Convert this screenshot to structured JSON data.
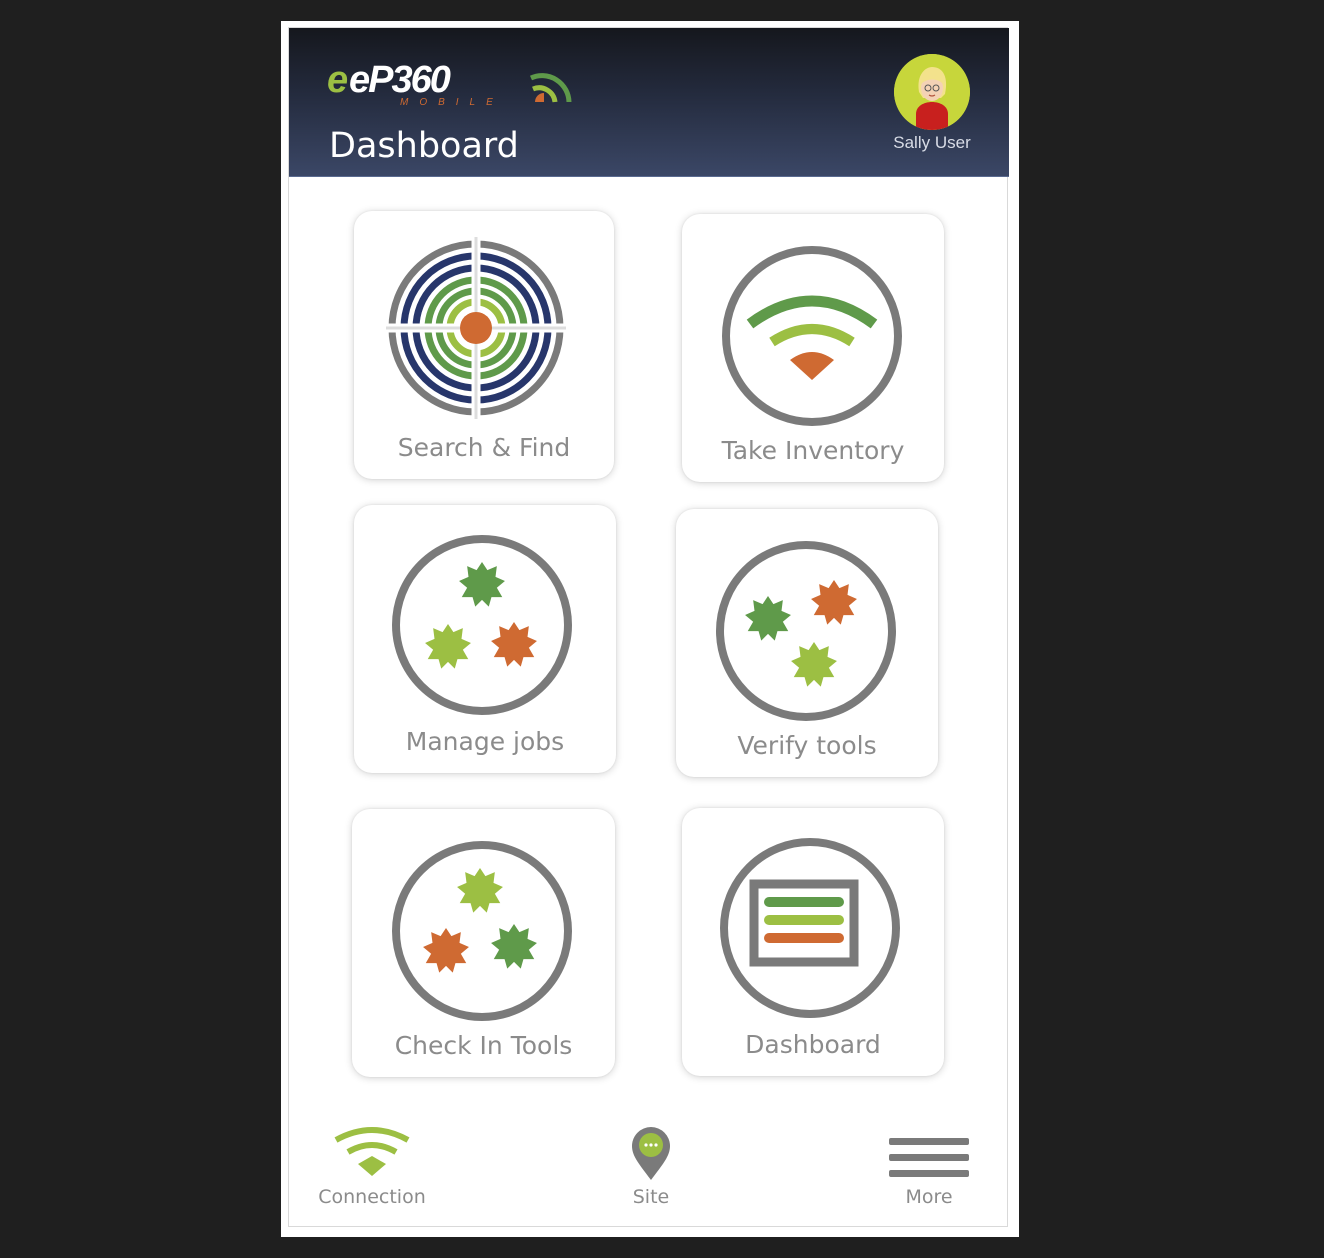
{
  "header": {
    "title": "Dashboard",
    "user_name": "Sally User",
    "logo_text": "eP360",
    "logo_subtext": "MOBILE"
  },
  "tiles": [
    {
      "label": "Search & Find",
      "icon": "target-icon"
    },
    {
      "label": "Take Inventory",
      "icon": "wifi-signal-icon"
    },
    {
      "label": "Manage jobs",
      "icon": "gears-icon"
    },
    {
      "label": "Verify tools",
      "icon": "gears-icon"
    },
    {
      "label": "Check In Tools",
      "icon": "gears-icon"
    },
    {
      "label": "Dashboard",
      "icon": "dashboard-list-icon"
    }
  ],
  "bottom_nav": {
    "connection": "Connection",
    "site": "Site",
    "more": "More"
  },
  "colors": {
    "dark_green": "#5f9a4a",
    "light_green": "#9cbf43",
    "orange": "#cf6a32",
    "navy": "#27366b",
    "gray": "#7a7a7a"
  }
}
